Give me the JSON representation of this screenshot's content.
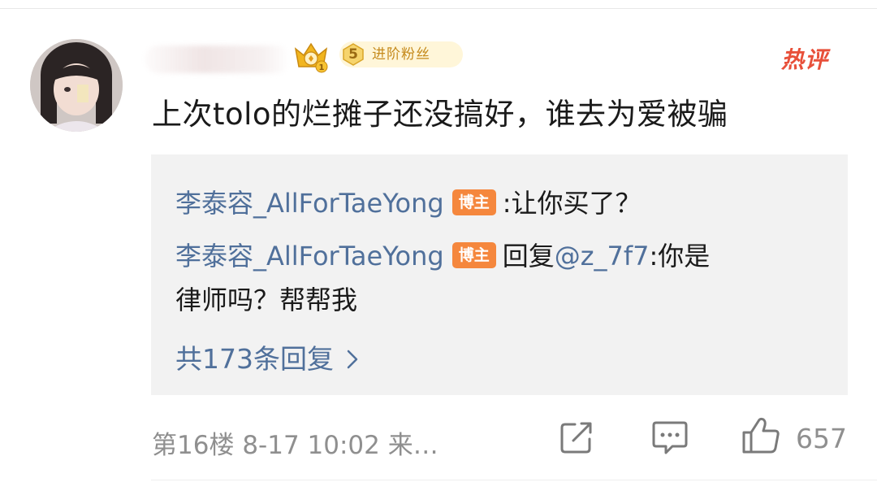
{
  "comment": {
    "fan_badge": {
      "level": "5",
      "label": "进阶粉丝"
    },
    "hot_tag": "热评",
    "text": "上次tolo的烂摊子还没搞好，谁去为爱被骗"
  },
  "replies": [
    {
      "user": "李泰容_AllForTaeYong",
      "tag": "博主",
      "separator": ":",
      "text": "让你买了？"
    },
    {
      "user": "李泰容_AllForTaeYong",
      "tag": "博主",
      "prefix": "回复",
      "mention": "@z_7f7",
      "separator": ":",
      "text_line1": "你是",
      "text_line2": "律师吗？帮帮我"
    }
  ],
  "reply_count_label": "共173条回复",
  "footer": {
    "floor": "第16楼",
    "time": "8-17 10:02",
    "source": "来…",
    "like_count": "657"
  },
  "icons": {
    "crown": "crown-badge-icon",
    "share": "share-icon",
    "comment": "comment-icon",
    "like": "thumbs-up-icon",
    "chevron": "chevron-right-icon"
  },
  "colors": {
    "link_blue": "#50709b",
    "hot_red": "#e8503a",
    "blogger_orange": "#f5873d",
    "fan_gold": "#c58a1c",
    "reply_bg": "#f2f2f2"
  }
}
